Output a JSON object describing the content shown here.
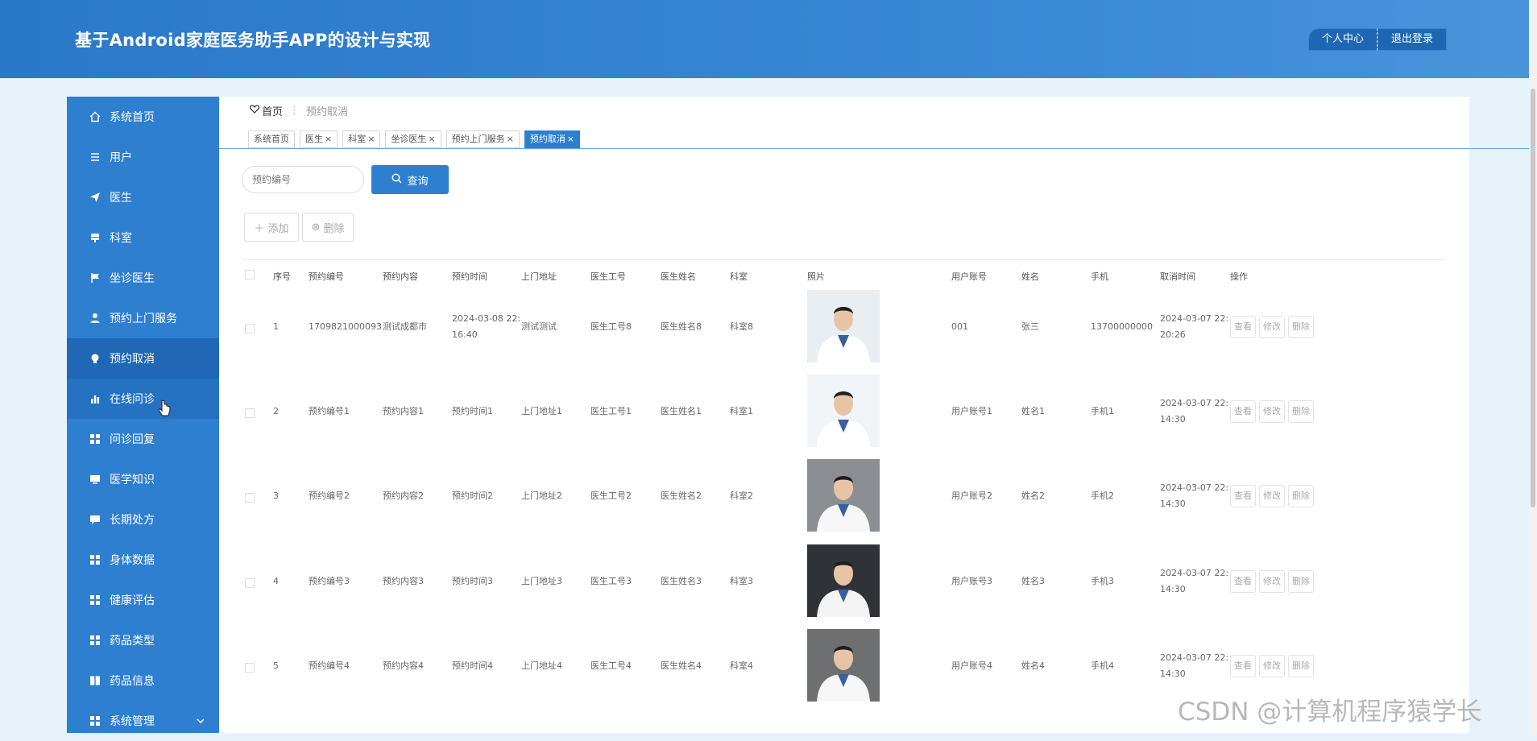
{
  "header": {
    "title": "基于Android家庭医务助手APP的设计与实现",
    "buttons": [
      "个人中心",
      "退出登录"
    ],
    "bg_color": "#2a78c8"
  },
  "sidebar": {
    "items": [
      {
        "label": "系统首页",
        "icon": "home-icon"
      },
      {
        "label": "用户",
        "icon": "list-icon"
      },
      {
        "label": "医生",
        "icon": "send-icon"
      },
      {
        "label": "科室",
        "icon": "signpost-icon"
      },
      {
        "label": "坐诊医生",
        "icon": "flag-icon"
      },
      {
        "label": "预约上门服务",
        "icon": "person-icon"
      },
      {
        "label": "预约取消",
        "icon": "bulb-icon",
        "active": true
      },
      {
        "label": "在线问诊",
        "icon": "bar-chart-icon",
        "hover": true
      },
      {
        "label": "问诊回复",
        "icon": "grid-icon"
      },
      {
        "label": "医学知识",
        "icon": "monitor-icon"
      },
      {
        "label": "长期处方",
        "icon": "comment-icon"
      },
      {
        "label": "身体数据",
        "icon": "grid-icon"
      },
      {
        "label": "健康评估",
        "icon": "grid-icon"
      },
      {
        "label": "药品类型",
        "icon": "grid-icon"
      },
      {
        "label": "药品信息",
        "icon": "book-icon"
      },
      {
        "label": "系统管理",
        "icon": "grid-icon",
        "expandable": true
      }
    ],
    "bg_color": "#2e7fd0",
    "active_color": "#2068b6"
  },
  "breadcrumb": {
    "home": "首页",
    "separator": "⋮",
    "current": "预约取消"
  },
  "tabs": [
    {
      "label": "系统首页",
      "closable": false
    },
    {
      "label": "医生",
      "closable": true
    },
    {
      "label": "科室",
      "closable": true
    },
    {
      "label": "坐诊医生",
      "closable": true
    },
    {
      "label": "预约上门服务",
      "closable": true
    },
    {
      "label": "预约取消",
      "closable": true,
      "active": true
    }
  ],
  "search": {
    "placeholder": "预约编号",
    "query_label": "查询"
  },
  "toolbar": {
    "add_label": "添加",
    "delete_label": "删除"
  },
  "table": {
    "columns": [
      "序号",
      "预约编号",
      "预约内容",
      "预约时间",
      "上门地址",
      "医生工号",
      "医生姓名",
      "科室",
      "照片",
      "用户账号",
      "姓名",
      "手机",
      "取消时间",
      "操作"
    ],
    "rows": [
      {
        "index": "1",
        "booking_no": "1709821000093",
        "content": "测试成都市",
        "time_line1": "2024-03-08 22:",
        "time_line2": "16:40",
        "address": "测试测试",
        "doc_no": "医生工号8",
        "doc_name": "医生姓名8",
        "dept": "科室8",
        "account": "001",
        "name": "张三",
        "phone": "13700000000",
        "cancel_line1": "2024-03-07 22:",
        "cancel_line2": "20:26"
      },
      {
        "index": "2",
        "booking_no": "预约编号1",
        "content": "预约内容1",
        "time_line1": "预约时间1",
        "time_line2": "",
        "address": "上门地址1",
        "doc_no": "医生工号1",
        "doc_name": "医生姓名1",
        "dept": "科室1",
        "account": "用户账号1",
        "name": "姓名1",
        "phone": "手机1",
        "cancel_line1": "2024-03-07 22:",
        "cancel_line2": "14:30"
      },
      {
        "index": "3",
        "booking_no": "预约编号2",
        "content": "预约内容2",
        "time_line1": "预约时间2",
        "time_line2": "",
        "address": "上门地址2",
        "doc_no": "医生工号2",
        "doc_name": "医生姓名2",
        "dept": "科室2",
        "account": "用户账号2",
        "name": "姓名2",
        "phone": "手机2",
        "cancel_line1": "2024-03-07 22:",
        "cancel_line2": "14:30"
      },
      {
        "index": "4",
        "booking_no": "预约编号3",
        "content": "预约内容3",
        "time_line1": "预约时间3",
        "time_line2": "",
        "address": "上门地址3",
        "doc_no": "医生工号3",
        "doc_name": "医生姓名3",
        "dept": "科室3",
        "account": "用户账号3",
        "name": "姓名3",
        "phone": "手机3",
        "cancel_line1": "2024-03-07 22:",
        "cancel_line2": "14:30"
      },
      {
        "index": "5",
        "booking_no": "预约编号4",
        "content": "预约内容4",
        "time_line1": "预约时间4",
        "time_line2": "",
        "address": "上门地址4",
        "doc_no": "医生工号4",
        "doc_name": "医生姓名4",
        "dept": "科室4",
        "account": "用户账号4",
        "name": "姓名4",
        "phone": "手机4",
        "cancel_line1": "2024-03-07 22:",
        "cancel_line2": "14:30"
      }
    ],
    "actions": [
      "查看",
      "修改",
      "删除"
    ]
  },
  "watermark": "CSDN @计算机程序猿学长"
}
